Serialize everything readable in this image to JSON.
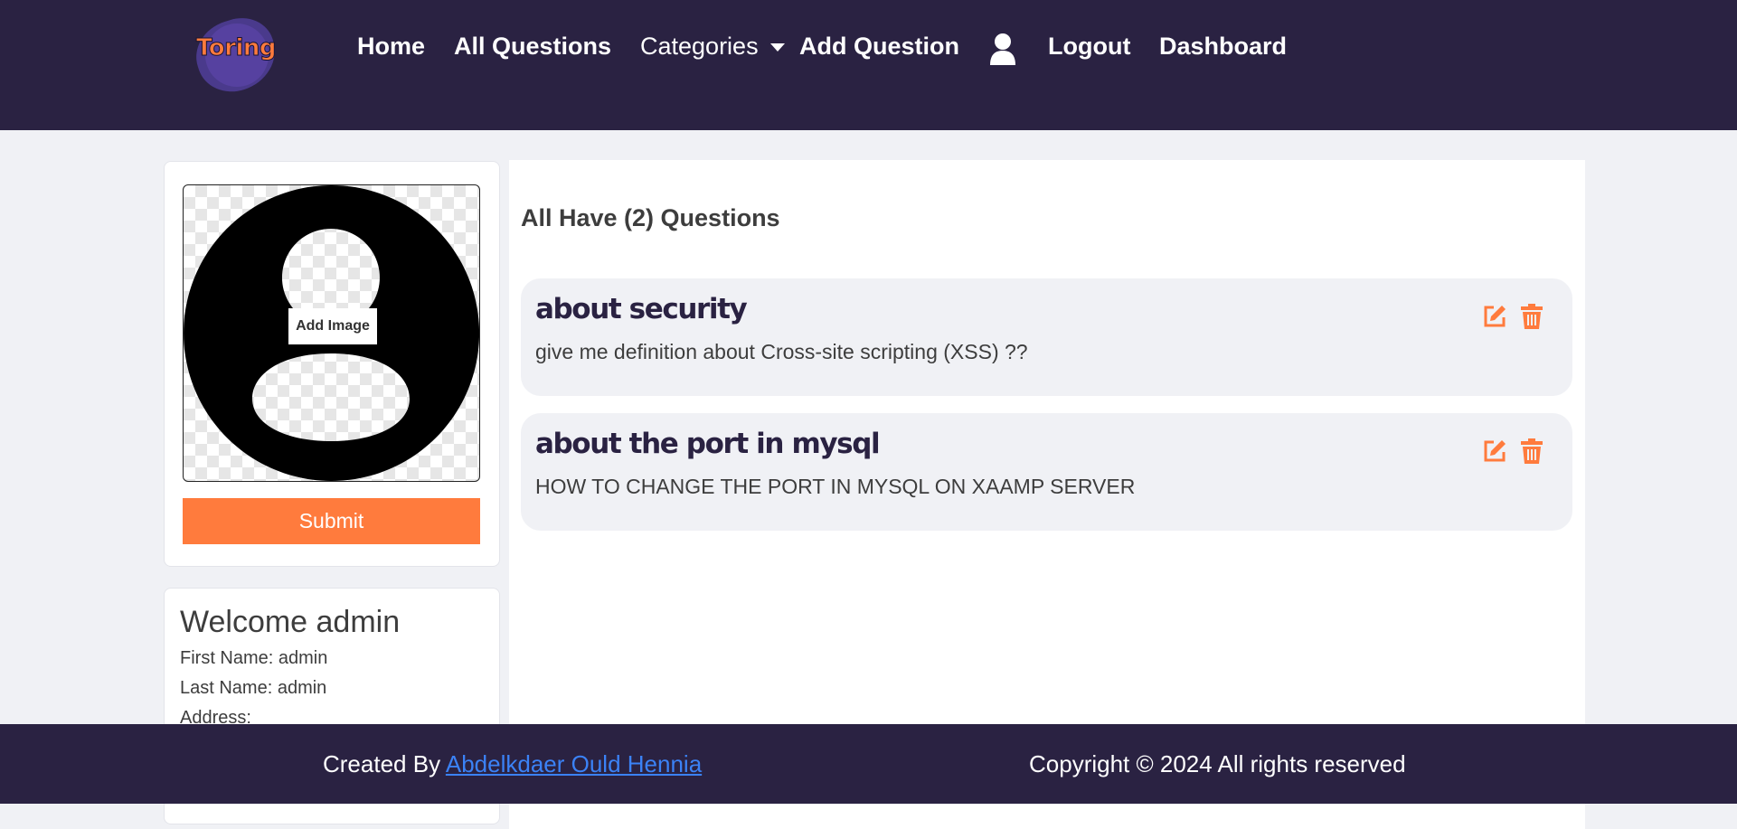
{
  "brand": {
    "logo_text": "Toring"
  },
  "nav": {
    "home": "Home",
    "all_questions": "All Questions",
    "categories": "Categories",
    "add_question": "Add Question",
    "user_icon": "user-icon",
    "logout": "Logout",
    "dashboard": "Dashboard"
  },
  "profile": {
    "add_image_label": "Add Image",
    "submit_label": "Submit",
    "welcome": "Welcome admin",
    "first_name": "First Name: admin",
    "last_name": "Last Name: admin",
    "address": "Address:"
  },
  "main": {
    "heading": "All Have (2) Questions",
    "questions": [
      {
        "title": "about security",
        "body": "give me definition about Cross-site scripting (XSS) ??",
        "edit_icon": "edit-icon",
        "delete_icon": "trash-icon"
      },
      {
        "title": "about the port in mysql",
        "body": "HOW TO CHANGE THE PORT IN MYSQL ON XAAMP SERVER",
        "edit_icon": "edit-icon",
        "delete_icon": "trash-icon"
      }
    ]
  },
  "footer": {
    "created_by": "Created By ",
    "author": "Abdelkdaer Ould Hennia",
    "copyright": "Copyright © 2024 All rights reserved"
  },
  "colors": {
    "nav_bg": "#2a2242",
    "accent": "#ff7b3d",
    "page_bg": "#f0f1f5",
    "link": "#3b82f6"
  }
}
